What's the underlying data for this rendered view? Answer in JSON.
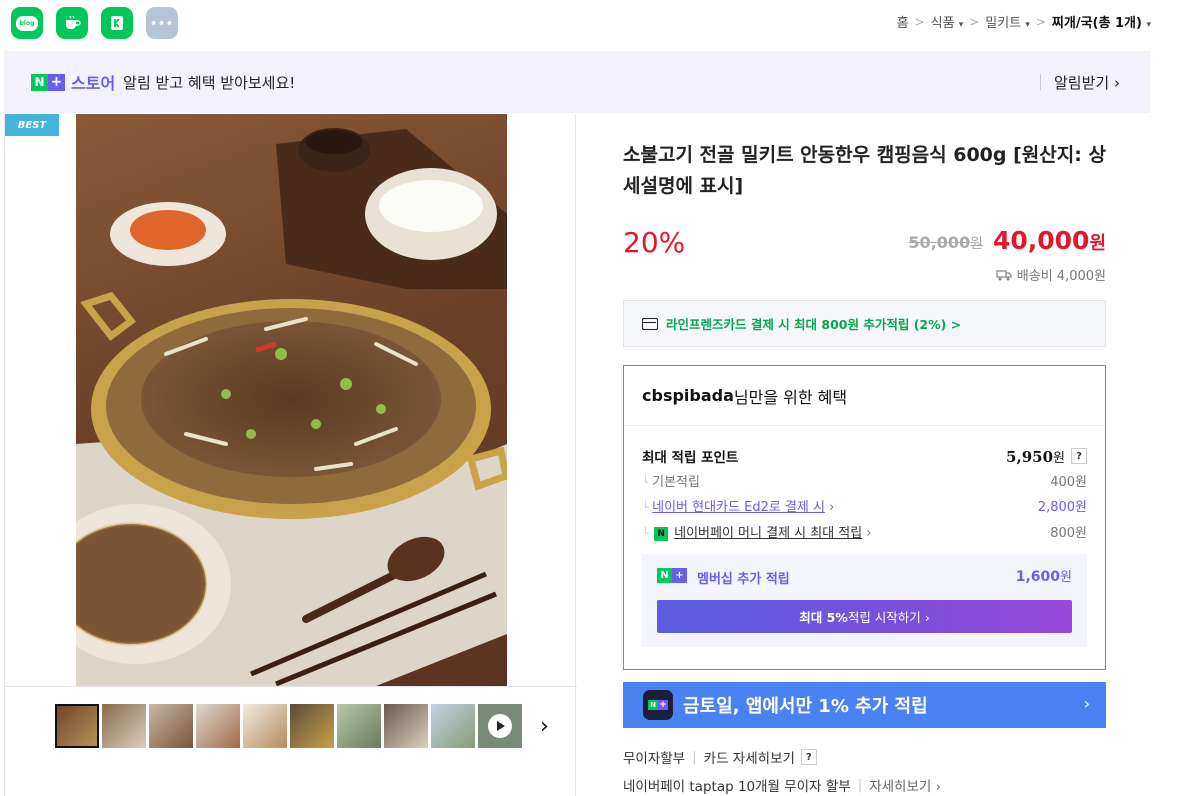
{
  "apps": [
    {
      "name": "blog",
      "label": "blog"
    },
    {
      "name": "cafe",
      "label": ""
    },
    {
      "name": "kinsta",
      "label": ""
    },
    {
      "name": "more",
      "label": "•••"
    }
  ],
  "breadcrumb": {
    "home": "홈",
    "sep": ">",
    "c1": "식품",
    "c2": "밀키트",
    "c3": "찌개/국(총 1개)",
    "caret": "▾"
  },
  "banner": {
    "n": "N",
    "plus": "+",
    "store": "스토어",
    "message": "알림 받고 혜택 받아보세요!",
    "alarm": "알림받기 ›"
  },
  "image": {
    "badge": "BEST",
    "next": "›"
  },
  "product": {
    "title": "소불고기 전골 밀키트 안동한우 캠핑음식 600g [원산지: 상세설명에 표시]",
    "discount": "20%",
    "original_price": "50,000",
    "sale_price": "40,000",
    "won": "원",
    "shipping": "배송비 4,000원"
  },
  "card_offer": "라인프렌즈카드 결제 시 최대 800원 추가적립 (2%) >",
  "benefit": {
    "user": "cbspibada",
    "title_suffix": "님만을 위한 혜택",
    "max_label": "최대 적립 포인트",
    "max_value": "5,950",
    "help": "?",
    "basic_label": "기본적립",
    "basic_value": "400원",
    "hyundai_label": "네이버 현대카드 Ed2로 결제 시",
    "hyundai_value": "2,800원",
    "npay_label": "네이버페이 머니 결제 시 최대 적립",
    "npay_value": "800원",
    "member_label": "멤버십 추가 적립",
    "member_value": "1,600",
    "member_btn_bold": "최대 5%",
    "member_btn_rest": " 적립 시작하기 ›"
  },
  "promo": {
    "text": "금토일, 앱에서만 1% 추가 적립",
    "arrow": "›"
  },
  "installment": {
    "label": "무이자할부",
    "card_detail": "카드 자세히보기",
    "help": "?",
    "taptap": "네이버페이 taptap 10개월 무이자 할부",
    "more": "자세히보기 ›"
  },
  "colors": {
    "naver_green": "#03c75a",
    "plus_purple": "#6b5cf0",
    "price_red": "#e5152b",
    "promo_blue": "#4a82f2"
  }
}
